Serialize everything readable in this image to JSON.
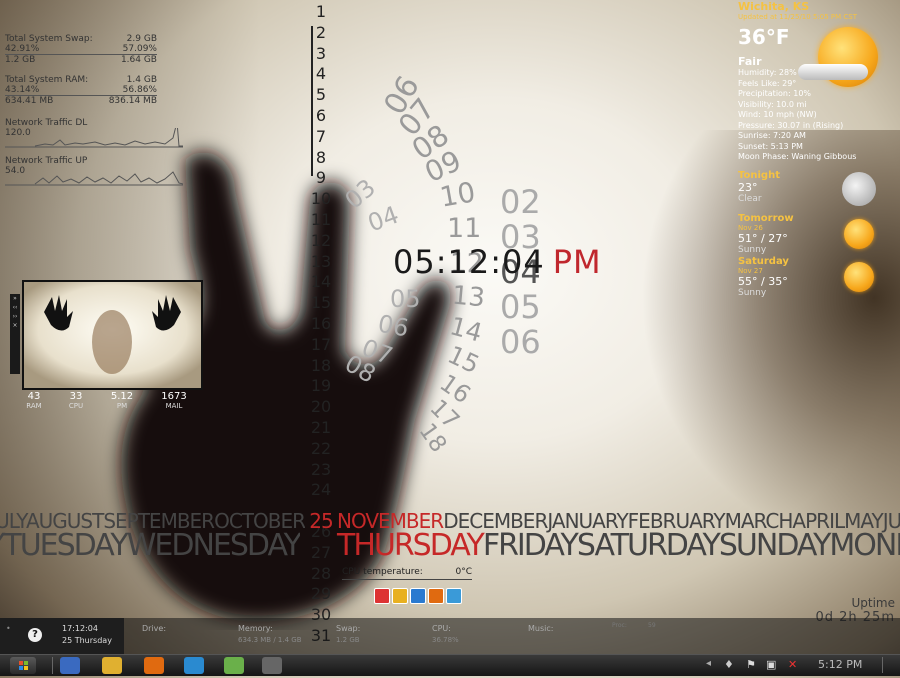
{
  "sysstats": {
    "swap_label": "Total System Swap:",
    "swap_total": "2.9 GB",
    "swap_pct_used": "42.91%",
    "swap_pct_free": "57.09%",
    "swap_used": "1.2 GB",
    "swap_free": "1.64 GB",
    "ram_label": "Total System RAM:",
    "ram_total": "1.4 GB",
    "ram_pct_used": "43.14%",
    "ram_pct_free": "56.86%",
    "ram_used": "634.41 MB",
    "ram_free": "836.14 MB",
    "dl_label": "Network Traffic DL",
    "dl_val": "120.0",
    "up_label": "Network Traffic UP",
    "up_val": "54.0"
  },
  "calendar": {
    "days": [
      "1",
      "2",
      "3",
      "4",
      "5",
      "6",
      "7",
      "8",
      "9",
      "10",
      "11",
      "12",
      "13",
      "14",
      "15",
      "16",
      "17",
      "18",
      "19",
      "20",
      "21",
      "22",
      "23",
      "24",
      "25",
      "26",
      "27",
      "28",
      "29",
      "30",
      "31"
    ],
    "today": "25",
    "months_before": "EJULYAUGUSTSEPTEMBEROCTOBER",
    "month_current": "NOVEMBER",
    "months_after": "DECEMBERJANUARYFEBRUARYMARCHAPRILMAYJUN",
    "weekdays_before": "YTUESDAYWEDNESDAY",
    "weekday_current": "THURSDAY",
    "weekdays_after": "FRIDAYSATURDAYSUNDAYMOND,"
  },
  "clock": {
    "time": "05:12:04",
    "ampm": "PM"
  },
  "spiral": {
    "minutes": [
      "02",
      "03",
      "04",
      "05",
      "06"
    ],
    "inner": [
      "06",
      "07",
      "08",
      "09",
      "10",
      "11",
      "12",
      "13",
      "14",
      "15",
      "16",
      "17",
      "18"
    ],
    "left": [
      "03",
      "04",
      "05",
      "06",
      "07",
      "08"
    ]
  },
  "weather": {
    "location": "Wichita, KS",
    "updated": "Updated at 11/25/10 5:05 PM CST",
    "temp": "36°F",
    "condition": "Fair",
    "details": [
      "Humidity: 28%",
      "Feels Like: 29°",
      "Precipitation: 10%",
      "Visibility: 10.0 mi",
      "Wind: 10 mph (NW)",
      "Pressure: 30.07 in (Rising)",
      "Sunrise: 7:20 AM",
      "Sunset: 5:13 PM",
      "Moon Phase: Waning Gibbous"
    ],
    "forecast": [
      {
        "day": "Tonight",
        "date": "",
        "temps": "23°",
        "cond": "Clear",
        "icon": "moon-icon"
      },
      {
        "day": "Tomorrow",
        "date": "Nov 26",
        "temps": "51° / 27°",
        "cond": "Sunny",
        "icon": "sun-icon"
      },
      {
        "day": "Saturday",
        "date": "Nov 27",
        "temps": "55° / 35°",
        "cond": "Sunny",
        "icon": "sun-icon"
      }
    ]
  },
  "media": {
    "stats": [
      {
        "value": "43",
        "label": "RAM"
      },
      {
        "value": "33",
        "label": "CPU"
      },
      {
        "value": "5.12",
        "label": "PM"
      },
      {
        "value": "1673",
        "label": "MAIL"
      }
    ]
  },
  "cpu_temp": {
    "label": "CPU temperature:",
    "value": "0°C"
  },
  "uptime": {
    "label": "Uptime",
    "value": "0d 2h 25m"
  },
  "infobar": {
    "time": "17:12:04",
    "date": "25 Thursday",
    "drive_label": "Drive:",
    "memory_label": "Memory:",
    "memory_value": "634.3 MB / 1.4 GB",
    "swap_label": "Swap:",
    "swap_value": "1.2 GB",
    "cpu_label": "CPU:",
    "cpu_value": "36.78%",
    "music_label": "Music:",
    "proc_label": "Proc:",
    "proc_value": "59"
  },
  "taskbar": {
    "clock": "5:12 PM"
  },
  "colors": {
    "accent_red": "#c62828",
    "weather_gold": "#f5c242"
  }
}
